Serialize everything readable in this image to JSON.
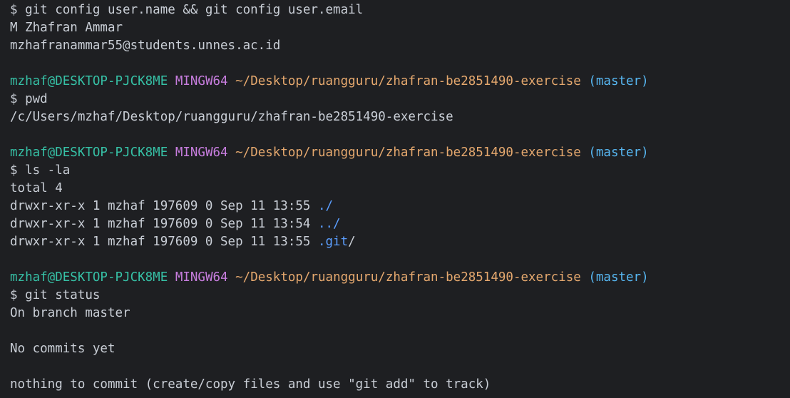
{
  "colors": {
    "background": "#1e1f22",
    "foreground": "#c9ced6",
    "user_host": "#36c1a6",
    "msys": "#c77dde",
    "path": "#e5a86e",
    "branch": "#57b7f2",
    "directory": "#5b9eff"
  },
  "prompt": {
    "user_host": "mzhaf@DESKTOP-PJCK8ME",
    "msys": "MINGW64",
    "cwd": "~/Desktop/ruangguru/zhafran-be2851490-exercise",
    "branch_open": "(",
    "branch": "master",
    "branch_close": ")"
  },
  "blocks": {
    "config": {
      "command": "$ git config user.name && git config user.email",
      "out": [
        "M Zhafran Ammar",
        "mzhafranammar55@students.unnes.ac.id"
      ]
    },
    "pwd": {
      "command": "$ pwd",
      "out": [
        "/c/Users/mzhaf/Desktop/ruangguru/zhafran-be2851490-exercise"
      ]
    },
    "ls": {
      "command": "$ ls -la",
      "total": "total 4",
      "rows": [
        {
          "meta": "drwxr-xr-x 1 mzhaf 197609 0 Sep 11 13:55 ",
          "name": "./",
          "suffix": ""
        },
        {
          "meta": "drwxr-xr-x 1 mzhaf 197609 0 Sep 11 13:54 ",
          "name": "../",
          "suffix": ""
        },
        {
          "meta": "drwxr-xr-x 1 mzhaf 197609 0 Sep 11 13:55 ",
          "name": ".git",
          "suffix": "/"
        }
      ]
    },
    "status": {
      "command": "$ git status",
      "out": [
        "On branch master",
        "No commits yet",
        "nothing to commit (create/copy files and use \"git add\" to track)"
      ]
    }
  }
}
